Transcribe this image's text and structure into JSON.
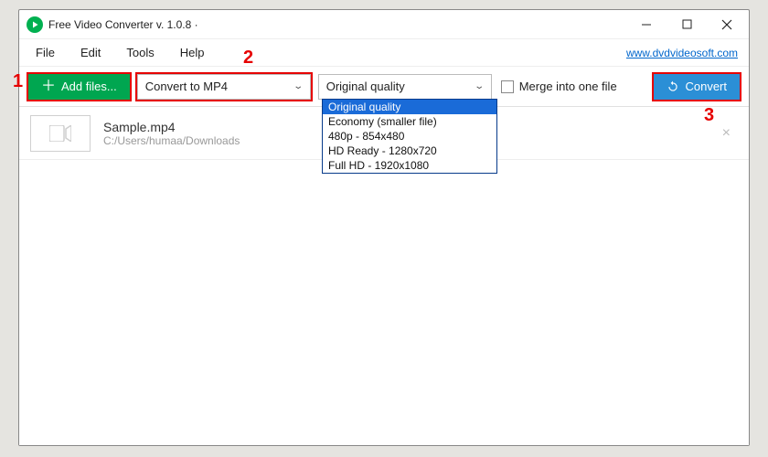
{
  "window": {
    "title": "Free Video Converter v. 1.0.8 ·"
  },
  "menubar": {
    "items": [
      "File",
      "Edit",
      "Tools",
      "Help"
    ],
    "link": "www.dvdvideosoft.com"
  },
  "toolbar": {
    "add_files_label": "Add files...",
    "format_selected": "Convert to MP4",
    "quality_selected": "Original quality",
    "quality_options": [
      "Original quality",
      "Economy (smaller file)",
      "480p - 854x480",
      "HD Ready - 1280x720",
      "Full HD - 1920x1080"
    ],
    "merge_label": "Merge into one file",
    "convert_label": "Convert"
  },
  "files": [
    {
      "name": "Sample.mp4",
      "path": "C:/Users/humaa/Downloads"
    }
  ],
  "annotations": {
    "n1": "1",
    "n2": "2",
    "n3": "3"
  }
}
